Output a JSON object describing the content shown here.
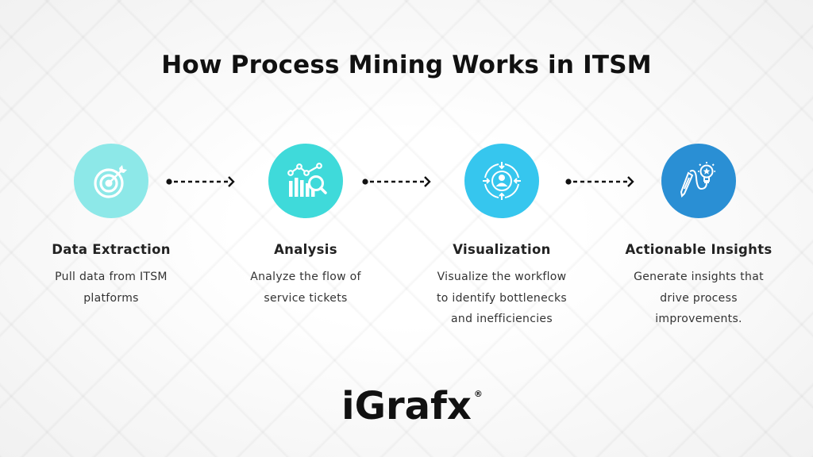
{
  "title": "How Process Mining Works in ITSM",
  "steps": [
    {
      "icon": "target-icon",
      "color": "#8de8e8",
      "title": "Data Extraction",
      "desc_lines": [
        "Pull data from ITSM",
        "platforms"
      ]
    },
    {
      "icon": "chart-magnifier-icon",
      "color": "#3fdada",
      "title": "Analysis",
      "desc_lines": [
        "Analyze the flow of",
        "service tickets"
      ]
    },
    {
      "icon": "user-cycle-icon",
      "color": "#36c6ee",
      "title": "Visualization",
      "desc_lines": [
        "Visualize the workflow",
        "to identify bottlenecks",
        "and inefficiencies"
      ]
    },
    {
      "icon": "pencil-lightbulb-icon",
      "color": "#2a8fd4",
      "title": "Actionable Insights",
      "desc_lines": [
        "Generate insights that",
        "drive process",
        "improvements."
      ]
    }
  ],
  "arrow_color": "#111111",
  "logo": {
    "text": "iGrafx",
    "registered": "®"
  }
}
